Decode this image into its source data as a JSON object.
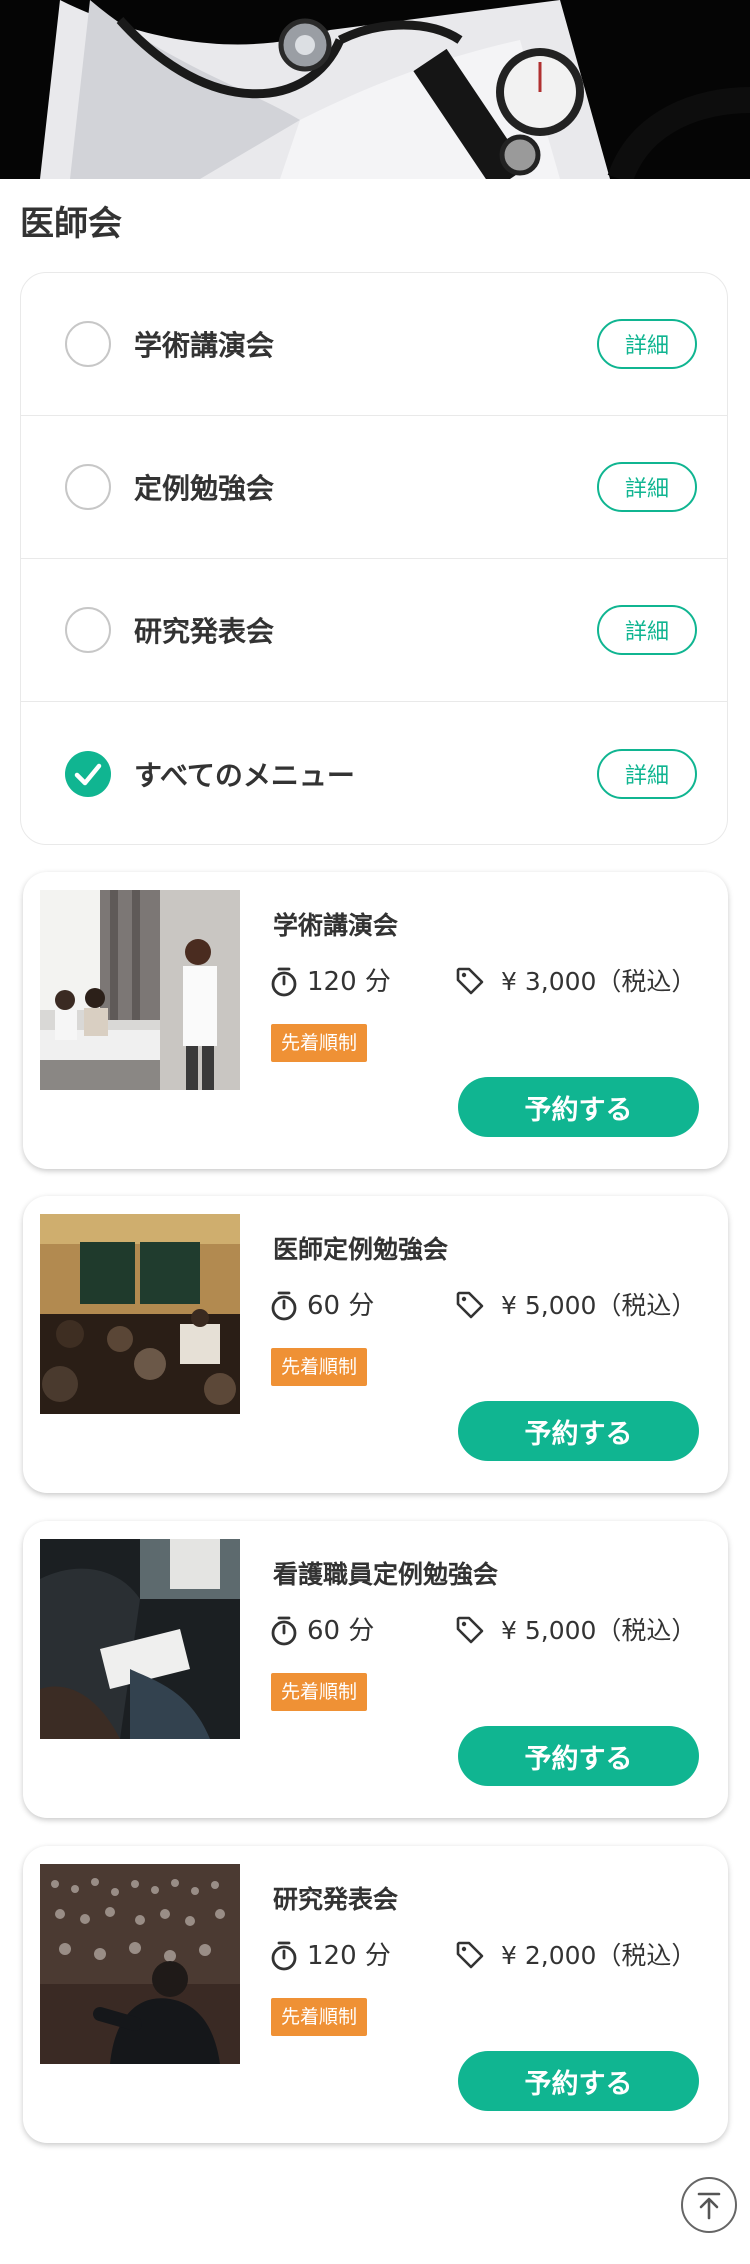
{
  "page": {
    "title": "医師会"
  },
  "menu": {
    "items": [
      {
        "label": "学術講演会",
        "checked": false,
        "detail_label": "詳細"
      },
      {
        "label": "定例勉強会",
        "checked": false,
        "detail_label": "詳細"
      },
      {
        "label": "研究発表会",
        "checked": false,
        "detail_label": "詳細"
      },
      {
        "label": "すべてのメニュー",
        "checked": true,
        "detail_label": "詳細"
      }
    ]
  },
  "courses": [
    {
      "title": "学術講演会",
      "duration": "120 分",
      "price": "¥ 3,000（税込）",
      "badge": "先着順制",
      "button": "予約する",
      "image": "lecture-with-speaker-photo"
    },
    {
      "title": "医師定例勉強会",
      "duration": "60 分",
      "price": "¥ 5,000（税込）",
      "badge": "先着順制",
      "button": "予約する",
      "image": "classroom-blackboard-photo"
    },
    {
      "title": "看護職員定例勉強会",
      "duration": "60 分",
      "price": "¥ 5,000（税込）",
      "badge": "先着順制",
      "button": "予約する",
      "image": "audience-with-notebook-photo"
    },
    {
      "title": "研究発表会",
      "duration": "120 分",
      "price": "¥ 2,000（税込）",
      "badge": "先着順制",
      "button": "予約する",
      "image": "conference-hall-photo"
    }
  ],
  "icons": {
    "timer": "timer-icon",
    "price_tag": "price-tag-icon",
    "check": "check-icon",
    "back_to_top": "arrow-up-to-top-icon"
  },
  "colors": {
    "accent": "#10b591",
    "badge": "#ef9135",
    "text": "#333333",
    "border": "#e9e9e9"
  }
}
